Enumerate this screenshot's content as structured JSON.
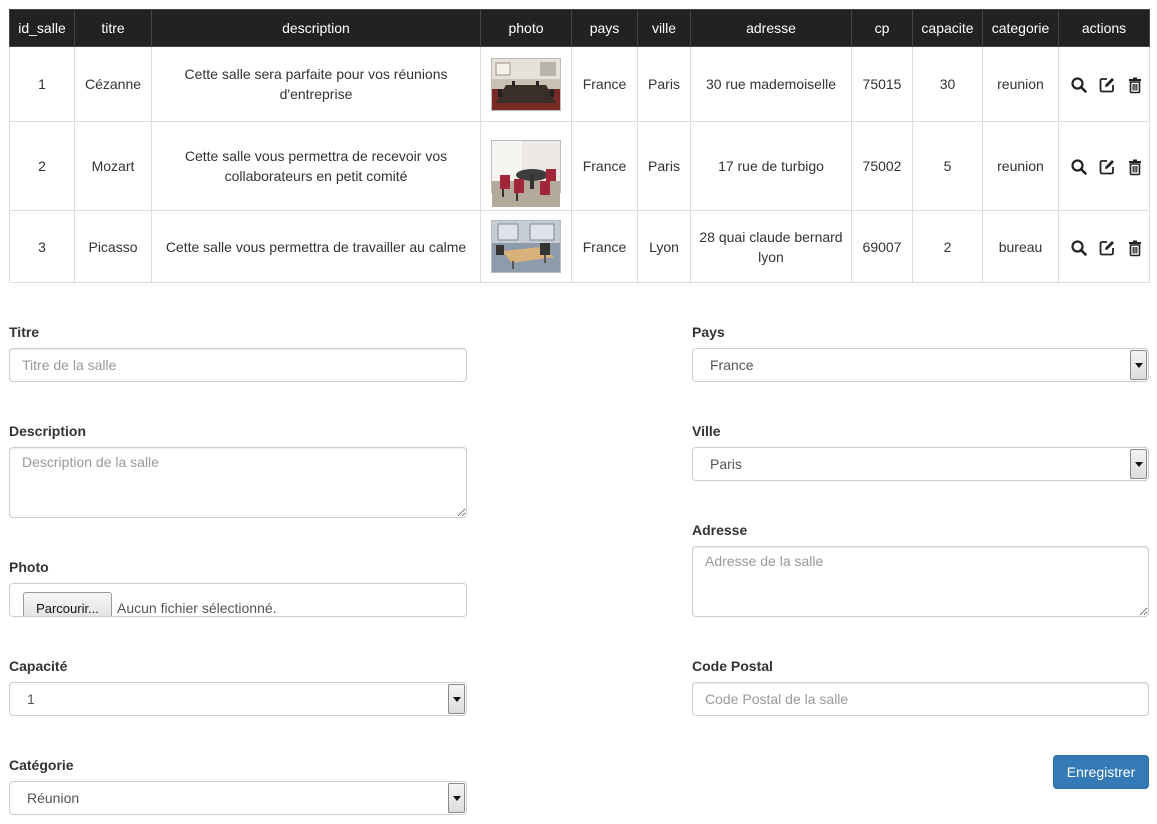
{
  "table": {
    "headers": [
      "id_salle",
      "titre",
      "description",
      "photo",
      "pays",
      "ville",
      "adresse",
      "cp",
      "capacite",
      "categorie",
      "actions"
    ],
    "rows": [
      {
        "id_salle": "1",
        "titre": "Cézanne",
        "description": "Cette salle sera parfaite pour vos réunions d'entreprise",
        "photo_icon": "meeting-room-photo",
        "pays": "France",
        "ville": "Paris",
        "adresse": "30 rue mademoiselle",
        "cp": "75015",
        "capacite": "30",
        "categorie": "reunion"
      },
      {
        "id_salle": "2",
        "titre": "Mozart",
        "description": "Cette salle vous permettra de recevoir vos collaborateurs en petit comité",
        "photo_icon": "small-meeting-room-photo",
        "pays": "France",
        "ville": "Paris",
        "adresse": "17 rue de turbigo",
        "cp": "75002",
        "capacite": "5",
        "categorie": "reunion"
      },
      {
        "id_salle": "3",
        "titre": "Picasso",
        "description": "Cette salle vous permettra de travailler au calme",
        "photo_icon": "office-room-photo",
        "pays": "France",
        "ville": "Lyon",
        "adresse": "28 quai claude bernard lyon",
        "cp": "69007",
        "capacite": "2",
        "categorie": "bureau"
      }
    ],
    "action_icons": [
      "search-icon",
      "edit-icon",
      "trash-icon"
    ]
  },
  "form": {
    "titre": {
      "label": "Titre",
      "placeholder": "Titre de la salle",
      "value": ""
    },
    "description": {
      "label": "Description",
      "placeholder": "Description de la salle",
      "value": ""
    },
    "photo": {
      "label": "Photo",
      "button": "Parcourir...",
      "filename": "Aucun fichier sélectionné."
    },
    "capacite": {
      "label": "Capacité",
      "selected": "1"
    },
    "categorie": {
      "label": "Catégorie",
      "selected": "Réunion"
    },
    "pays": {
      "label": "Pays",
      "selected": "France"
    },
    "ville": {
      "label": "Ville",
      "selected": "Paris"
    },
    "adresse": {
      "label": "Adresse",
      "placeholder": "Adresse de la salle",
      "value": ""
    },
    "cp": {
      "label": "Code Postal",
      "placeholder": "Code Postal de la salle",
      "value": ""
    },
    "submit": "Enregistrer"
  },
  "colors": {
    "header_bg": "#222222",
    "primary": "#337ab7",
    "border": "#dddddd"
  }
}
